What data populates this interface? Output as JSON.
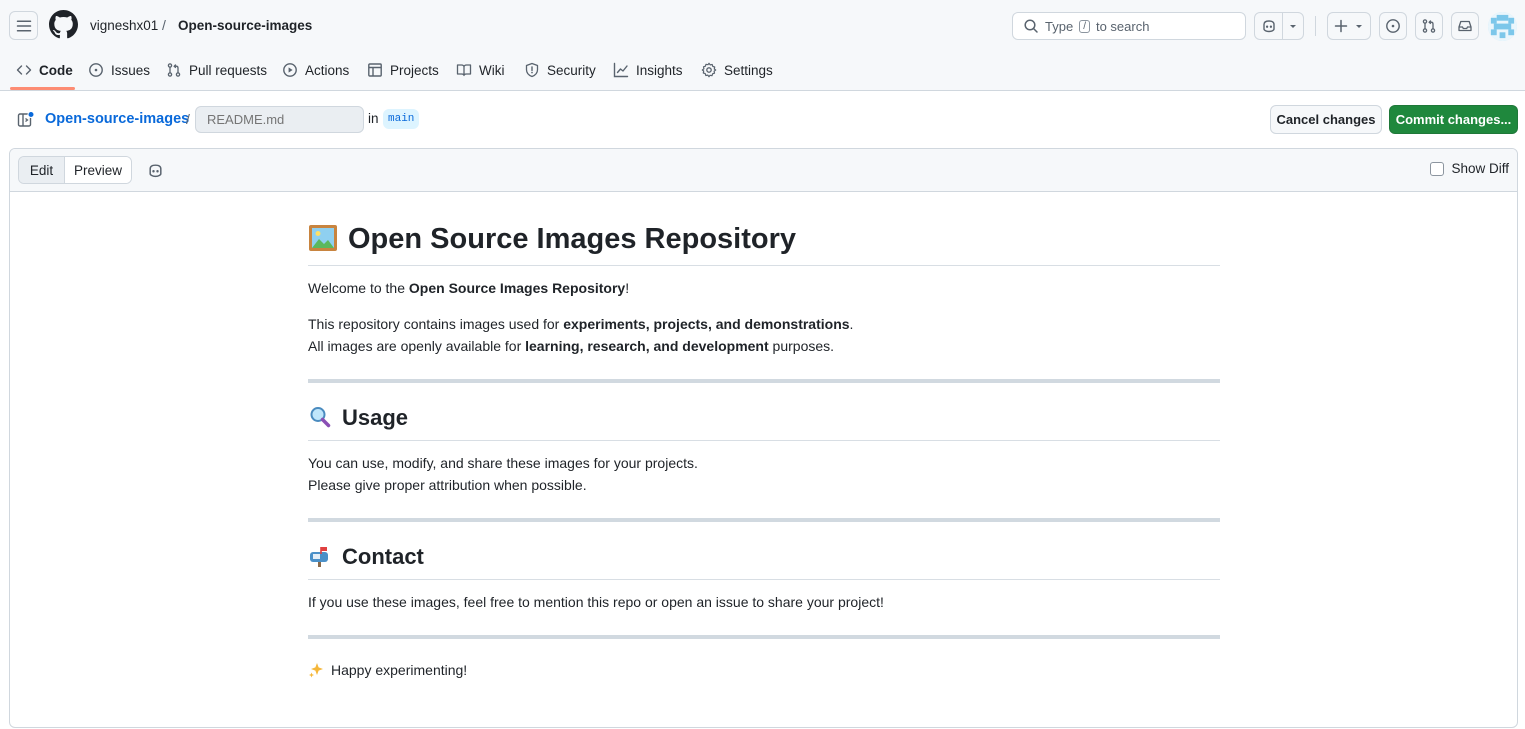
{
  "header": {
    "owner": "vigneshx01",
    "separator": "/",
    "repo": "Open-source-images",
    "search": {
      "prefix": "Type",
      "key": "/",
      "suffix": "to search"
    }
  },
  "tabs": [
    {
      "label": "Code",
      "icon": "code-icon",
      "active": true
    },
    {
      "label": "Issues",
      "icon": "issue-opened-icon"
    },
    {
      "label": "Pull requests",
      "icon": "git-pull-request-icon"
    },
    {
      "label": "Actions",
      "icon": "play-icon"
    },
    {
      "label": "Projects",
      "icon": "table-icon"
    },
    {
      "label": "Wiki",
      "icon": "book-icon"
    },
    {
      "label": "Security",
      "icon": "shield-icon"
    },
    {
      "label": "Insights",
      "icon": "graph-icon"
    },
    {
      "label": "Settings",
      "icon": "gear-icon"
    }
  ],
  "filebar": {
    "repo_link": "Open-source-images",
    "slash": "/",
    "filename_placeholder": "README.md",
    "in_label": "in",
    "branch": "main",
    "cancel_label": "Cancel changes",
    "commit_label": "Commit changes..."
  },
  "editor": {
    "edit_label": "Edit",
    "preview_label": "Preview",
    "show_diff_label": "Show Diff",
    "show_diff_checked": false
  },
  "preview": {
    "title": "Open Source Images Repository",
    "welcome": {
      "pre": "Welcome to the ",
      "bold": "Open Source Images Repository",
      "post": "!"
    },
    "intro1": {
      "pre": "This repository contains images used for ",
      "bold": "experiments, projects, and demonstrations",
      "post": "."
    },
    "intro2": {
      "pre": "All images are openly available for ",
      "bold": "learning, research, and development",
      "post": " purposes."
    },
    "usage_heading": "Usage",
    "usage_line1": "You can use, modify, and share these images for your projects.",
    "usage_line2": "Please give proper attribution when possible.",
    "contact_heading": "Contact",
    "contact_line": "If you use these images, feel free to mention this repo or open an issue to share your project!",
    "closing": "Happy experimenting!"
  },
  "colors": {
    "accent_link": "#0969da",
    "commit_green": "#1f883d",
    "tab_underline": "#fd8c73"
  }
}
